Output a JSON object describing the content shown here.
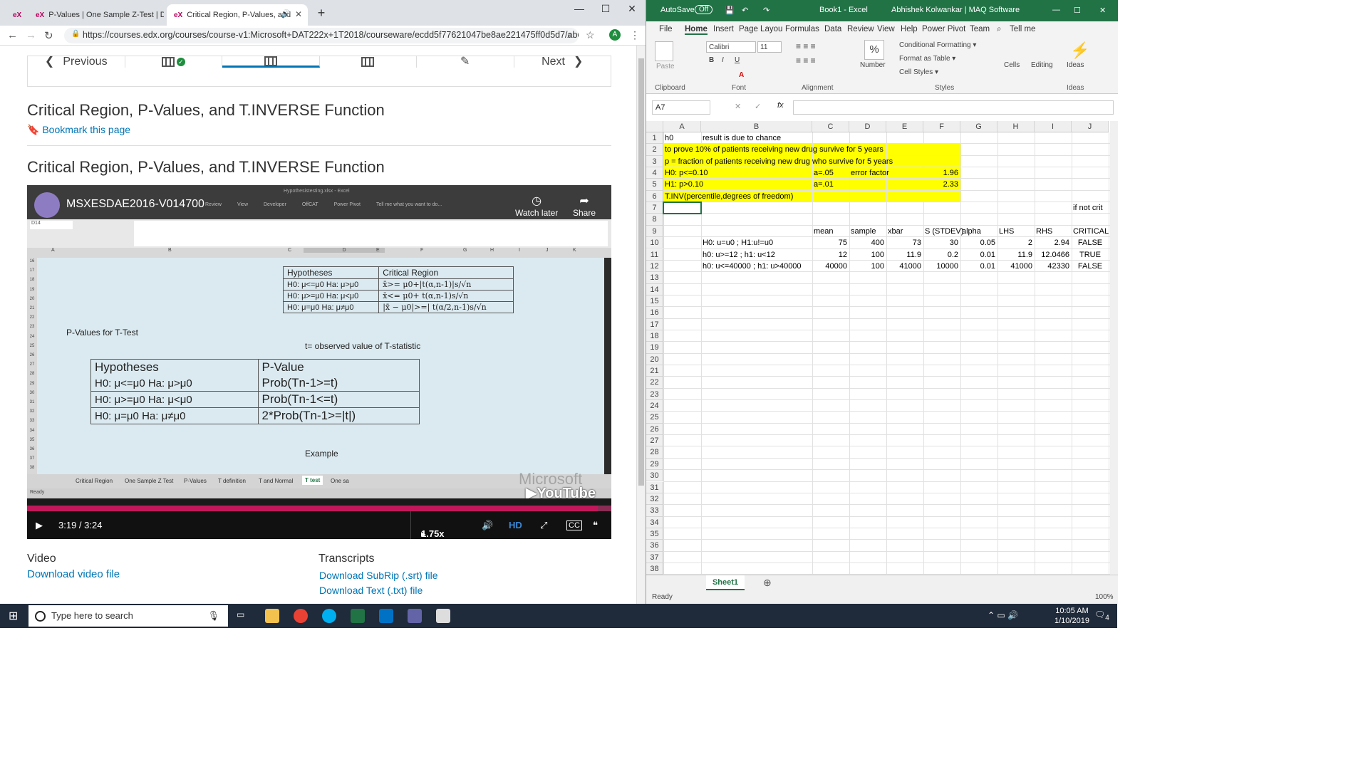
{
  "browser": {
    "tabs": [
      {
        "label": "P-Values | One Sample Z-Test | D",
        "icon": "eX"
      },
      {
        "label": "Critical Region, P-Values, and",
        "icon": "eX"
      }
    ],
    "first_tab_icon": "eX",
    "url": "https://courses.edx.org/courses/course-v1:Microsoft+DAT222x+1T2018/courseware/ecdd5f77621047be8ae221475ff0d5d7/ab0b8e...",
    "profile_initial": "A"
  },
  "edx": {
    "nav": {
      "previous": "Previous",
      "next": "Next"
    },
    "unit_title": "Critical Region, P-Values, and T.INVERSE Function",
    "bookmark": "Bookmark this page",
    "section_title": "Critical Region, P-Values, and T.INVERSE Function",
    "video": {
      "channel_title": "MSXESDAE2016-V014700",
      "watch_later": "Watch later",
      "share": "Share",
      "time": "3:19 / 3:24",
      "speed": "1.75x",
      "hd": "HD",
      "progress": 0.977,
      "inner_excel": {
        "ribbon_tabs": [
          "Review",
          "View",
          "Developer",
          "OffCAT",
          "Power Pivot"
        ],
        "tell_me": "Tell me what you want to do...",
        "file_title": "Hypothesistesting.xlsx - Excel",
        "namebox": "D14",
        "columns": [
          "A",
          "B",
          "C",
          "D",
          "E",
          "F",
          "G",
          "H",
          "I",
          "J",
          "K"
        ],
        "rows": [
          "16",
          "17",
          "18",
          "19",
          "20",
          "21",
          "22",
          "23",
          "24",
          "25",
          "26",
          "27",
          "28",
          "29",
          "30",
          "31",
          "32",
          "33",
          "34",
          "35",
          "36",
          "37",
          "38"
        ],
        "cr_table": {
          "headers": [
            "Hypotheses",
            "Critical Region"
          ],
          "rows": [
            [
              "H0: μ<=μ0 Ha: μ>μ0",
              "x̄>= μ0+|t(α,n-1)|s/√n"
            ],
            [
              "H0: μ>=μ0 Ha: μ<μ0",
              "x̄<= μ0+ t(α,n-1)s/√n"
            ],
            [
              "H0: μ=μ0 Ha: μ≠μ0",
              "|x̄ − μ0|>=| t(α/2,n-1)s/√n"
            ]
          ]
        },
        "pvalues_label": "P-Values for T-Test",
        "t_label": "t= observed value of T-statistic",
        "pv_table": {
          "headers": [
            "Hypotheses",
            "P-Value"
          ],
          "rows": [
            [
              "H0: μ<=μ0 Ha: μ>μ0",
              "Prob(Tn-1>=t)"
            ],
            [
              "H0: μ>=μ0 Ha: μ<μ0",
              "Prob(Tn-1<=t)"
            ],
            [
              "H0: μ=μ0 Ha: μ≠μ0",
              "2*Prob(Tn-1>=|t|)"
            ]
          ]
        },
        "example_label": "Example",
        "sheet_tabs": [
          "Critical Region",
          "One Sample Z Test",
          "P-Values",
          "T definition",
          "T and Normal",
          "T test",
          "One sa"
        ],
        "active_sheet": "T test",
        "status": "Ready",
        "watermark": "Microsoft",
        "youtube": "YouTube"
      }
    },
    "video_label": "Video",
    "download_video": "Download video file",
    "transcripts_label": "Transcripts",
    "download_srt": "Download SubRip (.srt) file",
    "download_txt": "Download Text (.txt) file"
  },
  "excel": {
    "autosave": "AutoSave",
    "autosave_state": "Off",
    "book": "Book1  -  Excel",
    "user": "Abhishek Kolwankar | MAQ Software",
    "menu": [
      "File",
      "Home",
      "Insert",
      "Page Layou",
      "Formulas",
      "Data",
      "Review",
      "View",
      "Help",
      "Power Pivot",
      "Team",
      "Tell me"
    ],
    "ribbon": {
      "paste": "Paste",
      "clipboard": "Clipboard",
      "font_name": "Calibri",
      "font_size": "11",
      "font": "Font",
      "alignment": "Alignment",
      "number": "Number",
      "cond_fmt": "Conditional Formatting",
      "format_table": "Format as Table",
      "cell_styles": "Cell Styles",
      "styles": "Styles",
      "cells": "Cells",
      "editing": "Editing",
      "ideas": "Ideas",
      "ideas_group": "Ideas"
    },
    "namebox": "A7",
    "columns": [
      "A",
      "B",
      "C",
      "D",
      "E",
      "F",
      "G",
      "H",
      "I",
      "J"
    ],
    "cells": {
      "A1": "h0",
      "B1": "result is due to chance",
      "A2": "to prove 10% of patients receiving new drug survive for 5 years",
      "A3": "p = fraction of patients receiving new drug who survive for 5 years",
      "A4": "H0: p<=0.10",
      "C4": "a=.05",
      "D4": "error factor",
      "F4": "1.96",
      "A5": "H1: p>0.10",
      "C5": "a=.01",
      "F5": "2.33",
      "A6": "T.INV(percentile,degrees of freedom)",
      "J7": "if not crit",
      "C9": "mean",
      "D9": "sample",
      "E9": "xbar",
      "F9": "S (STDEV)",
      "G9": "alpha",
      "H9": "LHS",
      "I9": "RHS",
      "J9": "CRITICAL",
      "B10": "H0: u=u0 ; H1:u!=u0",
      "C10": "75",
      "D10": "400",
      "E10": "73",
      "F10": "30",
      "G10": "0.05",
      "H10": "2",
      "I10": "2.94",
      "J10": "FALSE",
      "B11": "h0: u>=12 ; h1: u<12",
      "C11": "12",
      "D11": "100",
      "E11": "11.9",
      "F11": "0.2",
      "G11": "0.01",
      "H11": "11.9",
      "I11": "12.0466",
      "J11": "TRUE",
      "B12": "h0: u<=40000 ; h1: u>40000",
      "C12": "40000",
      "D12": "100",
      "E12": "41000",
      "F12": "10000",
      "G12": "0.01",
      "H12": "41000",
      "I12": "42330",
      "J12": "FALSE"
    },
    "sheet_tab": "Sheet1",
    "status": "Ready",
    "zoom": "100%"
  },
  "taskbar": {
    "search_placeholder": "Type here to search",
    "time": "10:05 AM",
    "date": "1/10/2019",
    "notifications": "4"
  }
}
